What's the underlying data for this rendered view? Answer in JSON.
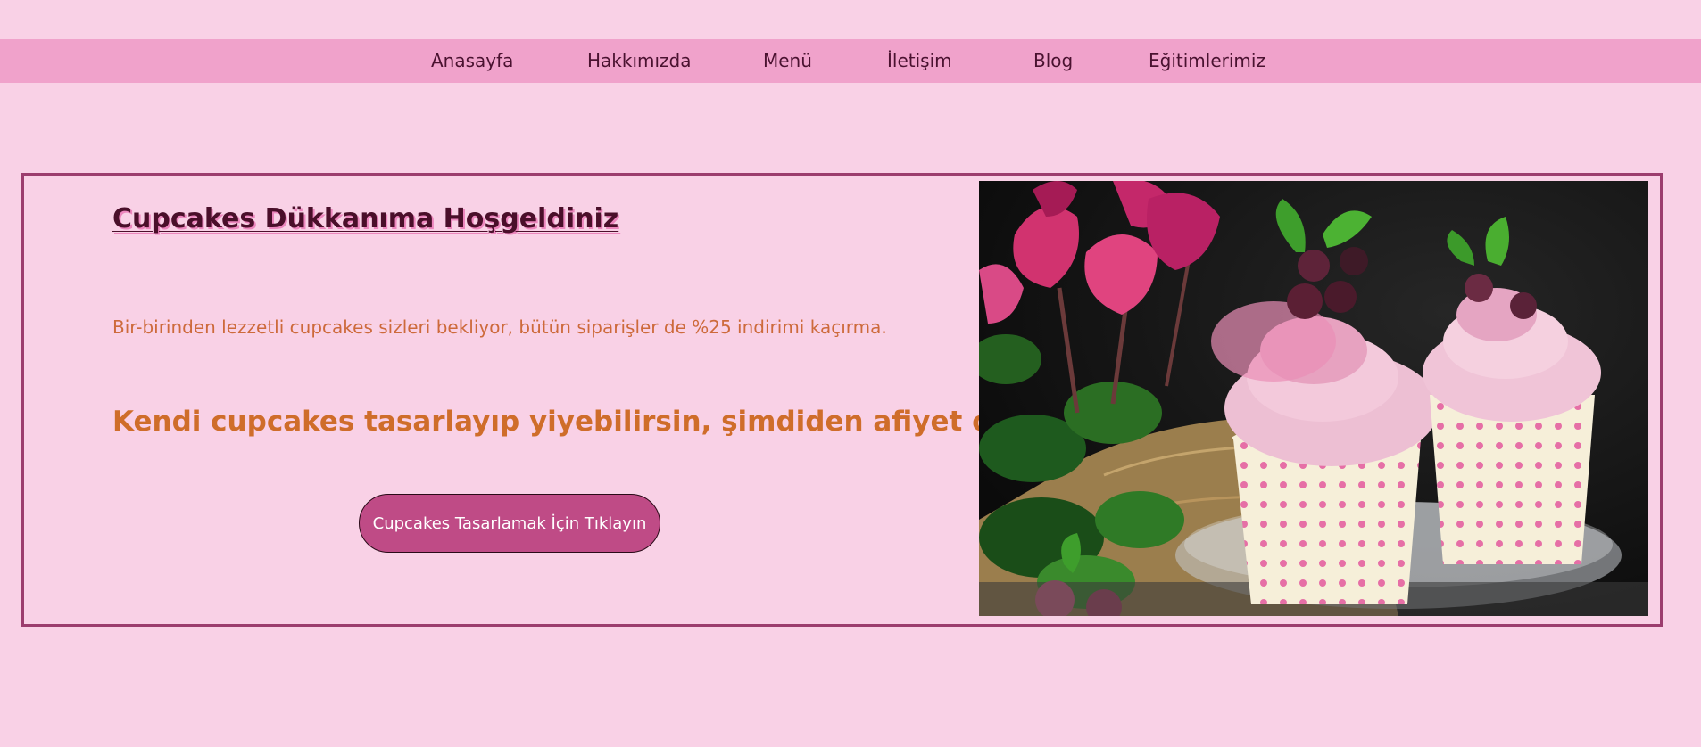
{
  "nav": {
    "items": [
      {
        "label": "Anasayfa"
      },
      {
        "label": "Hakkımızda"
      },
      {
        "label": "Menü"
      },
      {
        "label": "İletişim"
      },
      {
        "label": "Blog"
      },
      {
        "label": "Eğitimlerimiz"
      }
    ]
  },
  "hero": {
    "title": "Cupcakes Dükkanıma Hoşgeldiniz",
    "text": "Bir-birinden lezzetli cupcakes sizleri bekliyor, bütün siparişler de %25 indirimi kaçırma.",
    "slogan": "Kendi cupcakes tasarlayıp yiyebilirsin, şimdiden afiyet olsun.",
    "button_label": "Cupcakes Tasarlamak İçin Tıklayın",
    "image": "cupcakes-photo"
  },
  "colors": {
    "background": "#f9d1e6",
    "navbar": "#f0a2cb",
    "border": "#9c3d6e",
    "title": "#4a0f2a",
    "text": "#cd6a3b",
    "button": "#bf4b86"
  }
}
